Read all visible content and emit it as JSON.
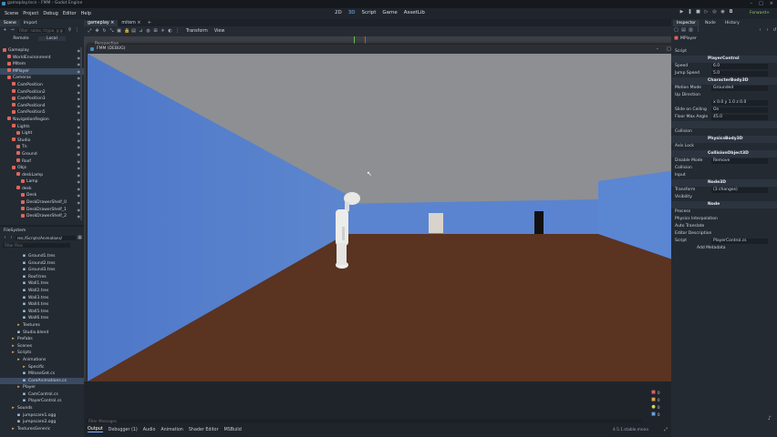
{
  "window": {
    "title": "gameplay.tscn - FMM - Godot Engine"
  },
  "menu": [
    "Scene",
    "Project",
    "Debug",
    "Editor",
    "Help"
  ],
  "workspaces": [
    {
      "label": "2D",
      "active": false
    },
    {
      "label": "3D",
      "active": true
    },
    {
      "label": "Script",
      "active": false
    },
    {
      "label": "Game",
      "active": false
    },
    {
      "label": "AssetLib",
      "active": false
    }
  ],
  "renderer": "Forward+",
  "scene_dock": {
    "tabs": [
      "Scene",
      "Import"
    ],
    "filter_placeholder": "Filter: name, t:type, g:group",
    "toggle": [
      "Remote",
      "Local"
    ],
    "tree": [
      {
        "label": "Gameplay",
        "depth": 0,
        "color": "#e0665a"
      },
      {
        "label": "WorldEnvironment",
        "depth": 1,
        "color": "#e0665a"
      },
      {
        "label": "MItem",
        "depth": 1,
        "color": "#e0665a"
      },
      {
        "label": "MPlayer",
        "depth": 1,
        "color": "#e0665a",
        "selected": true
      },
      {
        "label": "Cameras",
        "depth": 1,
        "color": "#e0665a"
      },
      {
        "label": "CamPosition",
        "depth": 2,
        "color": "#e0665a"
      },
      {
        "label": "CamPosition2",
        "depth": 2,
        "color": "#e0665a"
      },
      {
        "label": "CamPosition3",
        "depth": 2,
        "color": "#e0665a"
      },
      {
        "label": "CamPosition4",
        "depth": 2,
        "color": "#e0665a"
      },
      {
        "label": "CamPosition5",
        "depth": 2,
        "color": "#e0665a"
      },
      {
        "label": "NavigationRegion",
        "depth": 1,
        "color": "#e0665a"
      },
      {
        "label": "Lights",
        "depth": 2,
        "color": "#e0665a"
      },
      {
        "label": "Light",
        "depth": 3,
        "color": "#e0665a"
      },
      {
        "label": "Studio",
        "depth": 2,
        "color": "#e0665a"
      },
      {
        "label": "Tn",
        "depth": 3,
        "color": "#e0665a"
      },
      {
        "label": "Ground",
        "depth": 3,
        "color": "#e0665a"
      },
      {
        "label": "Roof",
        "depth": 3,
        "color": "#e0665a"
      },
      {
        "label": "Objs",
        "depth": 2,
        "color": "#e0665a"
      },
      {
        "label": "deskLamp",
        "depth": 3,
        "color": "#e0665a"
      },
      {
        "label": "Lamp",
        "depth": 4,
        "color": "#e0665a"
      },
      {
        "label": "desk",
        "depth": 3,
        "color": "#e0665a"
      },
      {
        "label": "Desk",
        "depth": 4,
        "color": "#e0665a"
      },
      {
        "label": "DeskDrawerShelf_0",
        "depth": 4,
        "color": "#e0665a"
      },
      {
        "label": "DeskDrawerShelf_1",
        "depth": 4,
        "color": "#e0665a"
      },
      {
        "label": "DeskDrawerShelf_2",
        "depth": 4,
        "color": "#e0665a"
      }
    ]
  },
  "filesystem": {
    "title": "FileSystem",
    "path": "res://Scripts/Animations/",
    "filter_placeholder": "Filter Files",
    "items": [
      {
        "label": "Ground1.tres",
        "depth": 3
      },
      {
        "label": "Ground2.tres",
        "depth": 3
      },
      {
        "label": "Ground3.tres",
        "depth": 3
      },
      {
        "label": "Roof.tres",
        "depth": 3
      },
      {
        "label": "Wall1.tres",
        "depth": 3
      },
      {
        "label": "Wall2.tres",
        "depth": 3
      },
      {
        "label": "Wall3.tres",
        "depth": 3
      },
      {
        "label": "Wall4.tres",
        "depth": 3
      },
      {
        "label": "Wall5.tres",
        "depth": 3
      },
      {
        "label": "Wall6.tres",
        "depth": 3
      },
      {
        "label": "Textures",
        "depth": 2
      },
      {
        "label": "Studio.blend",
        "depth": 2
      },
      {
        "label": "Prefabs",
        "depth": 1
      },
      {
        "label": "Scenes",
        "depth": 1
      },
      {
        "label": "Scripts",
        "depth": 1
      },
      {
        "label": "Animations",
        "depth": 2
      },
      {
        "label": "Specific",
        "depth": 3
      },
      {
        "label": "MitoseGet.cs",
        "depth": 3
      },
      {
        "label": "CoreAnimations.cs",
        "depth": 3,
        "selected": true
      },
      {
        "label": "Player",
        "depth": 2
      },
      {
        "label": "CamControl.cs",
        "depth": 3
      },
      {
        "label": "PlayerControl.cs",
        "depth": 3
      },
      {
        "label": "Sounds",
        "depth": 1
      },
      {
        "label": "jumpscare1.ogg",
        "depth": 2
      },
      {
        "label": "jumpscare2.ogg",
        "depth": 2
      },
      {
        "label": "TexturesGeneric",
        "depth": 1
      }
    ]
  },
  "editor_tabs": [
    {
      "label": "gameplay",
      "active": true
    },
    {
      "label": "mitem",
      "active": false
    }
  ],
  "viewport": {
    "perspective_label": "Perspective",
    "transform_label": "Transform",
    "view_label": "View"
  },
  "game_window": {
    "title": "FMM (DEBUG)"
  },
  "inspector": {
    "tabs": [
      "Inspector",
      "Node",
      "History"
    ],
    "node_name": "MPlayer",
    "rows": [
      {
        "label": "Script",
        "value": ""
      },
      {
        "label": "",
        "value": "PlayerControl",
        "section": true
      },
      {
        "label": "Speed",
        "value": "6.0"
      },
      {
        "label": "Jump Speed",
        "value": "5.0"
      },
      {
        "label": "",
        "value": "CharacterBody3D",
        "section": true
      },
      {
        "label": "Motion Mode",
        "value": "Grounded"
      },
      {
        "label": "Up Direction",
        "value": ""
      },
      {
        "label": "",
        "value": "x 0.0   y 1.0   z 0.0"
      },
      {
        "label": "Slide on Ceiling",
        "value": "On"
      },
      {
        "label": "Floor Max Angle",
        "value": "45.0"
      },
      {
        "label": "Moving Platform",
        "value": "",
        "section": true
      },
      {
        "label": "Collision",
        "value": ""
      },
      {
        "label": "",
        "value": "PhysicsBody3D",
        "section": true
      },
      {
        "label": "Axis Lock",
        "value": ""
      },
      {
        "label": "",
        "value": "CollisionObject3D",
        "section": true
      },
      {
        "label": "Disable Mode",
        "value": "Remove"
      },
      {
        "label": "Collision",
        "value": ""
      },
      {
        "label": "Input",
        "value": ""
      },
      {
        "label": "",
        "value": "Node3D",
        "section": true
      },
      {
        "label": "Transform",
        "value": "(3 changes)"
      },
      {
        "label": "Visibility",
        "value": ""
      },
      {
        "label": "",
        "value": "Node",
        "section": true
      },
      {
        "label": "Process",
        "value": ""
      },
      {
        "label": "Physics Interpolation",
        "value": ""
      },
      {
        "label": "Auto Translate",
        "value": ""
      },
      {
        "label": "Editor Description",
        "value": ""
      },
      {
        "label": "Script",
        "value": "PlayerControl.cs"
      },
      {
        "label": "",
        "value": "Add Metadata",
        "button": true
      }
    ]
  },
  "bottom_panel": {
    "filter_placeholder": "Filter Messages",
    "tabs": [
      {
        "label": "Output",
        "active": true
      },
      {
        "label": "Debugger (1)",
        "active": false
      },
      {
        "label": "Audio",
        "active": false
      },
      {
        "label": "Animation",
        "active": false
      },
      {
        "label": "Shader Editor",
        "active": false
      },
      {
        "label": "MSBuild",
        "active": false
      }
    ],
    "version": "4.5.1.stable.mono",
    "counts": [
      "0",
      "0",
      "0",
      "0"
    ]
  },
  "colors": {
    "accent": "#7eb7ff",
    "wall": "#4f79c6",
    "floor": "#5a3321",
    "sky": "#8e9094",
    "selected": "#3a4a60"
  }
}
